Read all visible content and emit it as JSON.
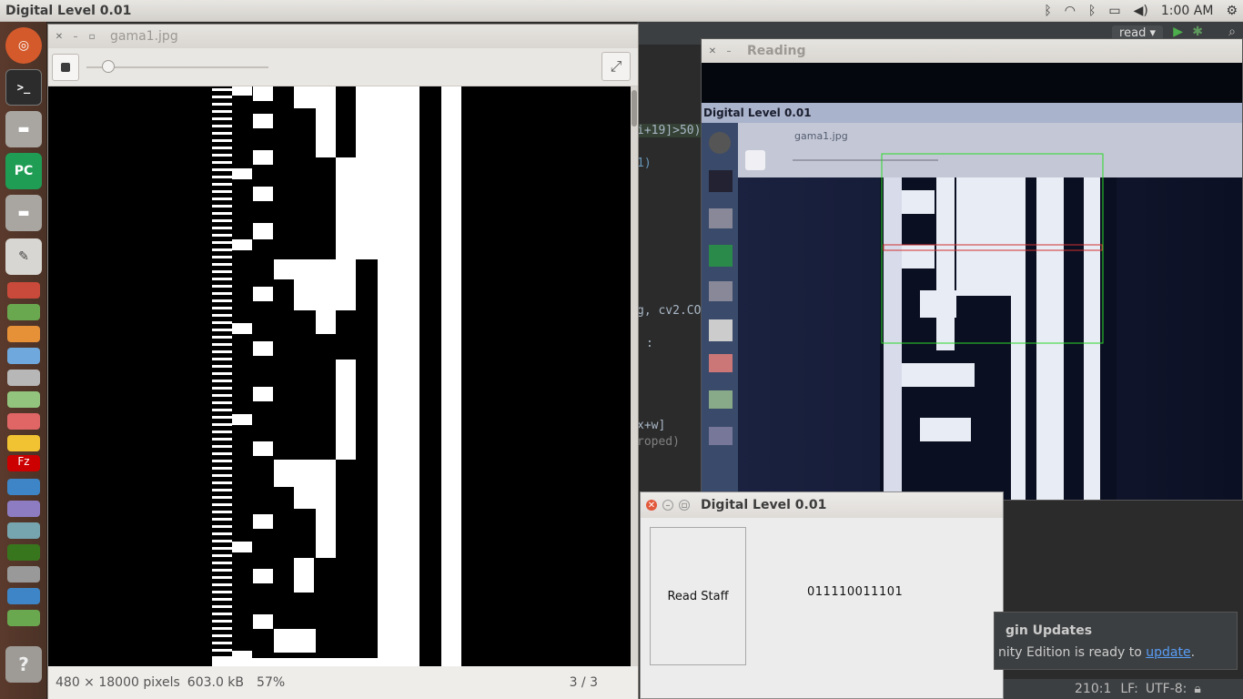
{
  "topbar": {
    "app_title": "Digital Level 0.01",
    "indicators": [
      "bluetooth-icon",
      "wifi-icon",
      "bluetooth-icon",
      "battery-icon",
      "volume-icon"
    ],
    "clock": "1:00 AM"
  },
  "launcher": {
    "items": [
      "ubuntu-home",
      "terminal",
      "files",
      "pycharm",
      "files",
      "text-editor",
      "app-icon",
      "app-icon",
      "app-icon",
      "app-icon",
      "app-icon",
      "app-icon",
      "app-icon",
      "app-icon",
      "filezilla",
      "app-icon",
      "app-icon",
      "app-icon",
      "app-icon",
      "app-icon",
      "bluetooth",
      "app-icon",
      "help"
    ],
    "pycharm_label": "PC",
    "help_label": "?"
  },
  "editor": {
    "run_config": "read",
    "code_fragments": [
      "i+19]>50)",
      "1)",
      "g, cv2.CO",
      ":",
      "x+w]",
      "roped)"
    ]
  },
  "viewer": {
    "title": "gama1.jpg",
    "zoom_level": 0.12,
    "status": {
      "dimensions": "480 × 18000 pixels",
      "size": "603.0 kB",
      "zoom": "57%",
      "page": "3 / 3"
    }
  },
  "reading": {
    "title": "Reading",
    "inner_app_title": "Digital Level 0.01",
    "inner_file_title": "gama1.jpg"
  },
  "dialog": {
    "title": "Digital Level 0.01",
    "read_button": "Read Staff",
    "result": "011110011101"
  },
  "notification": {
    "title": "gin Updates",
    "body_prefix": "nity Edition is ready to",
    "link": "update",
    "suffix": "."
  },
  "ide_status": {
    "position": "210:1",
    "line_ending": "LF:",
    "encoding": "UTF-8:"
  }
}
